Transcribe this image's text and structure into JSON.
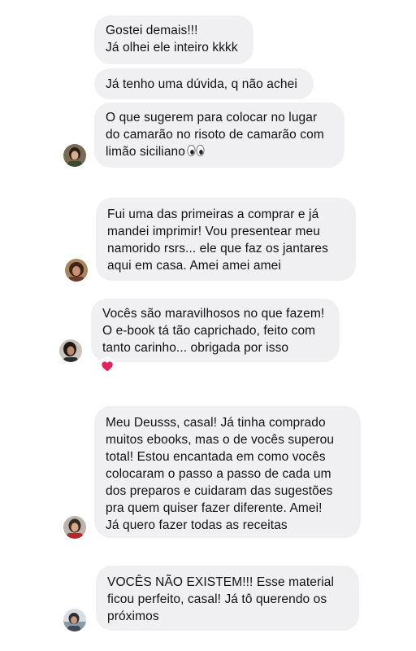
{
  "messages": [
    {
      "author": "user-1",
      "bubbles": [
        "Gostei demais!!!\nJá olhei ele inteiro kkkk",
        "Já tenho uma dúvida, q não achei",
        "O que sugerem para colocar no lugar\ndo camarão no risoto de camarão com\nlimão siciliano"
      ],
      "emoji": "eyes"
    },
    {
      "author": "user-2",
      "bubbles": [
        "Fui uma das primeiras a comprar e já\nmandei imprimir! Vou presentear meu\nnamorido rsrs... ele que faz os jantares\naqui em casa. Amei amei amei"
      ]
    },
    {
      "author": "user-3",
      "bubbles": [
        "Vocês são maravilhosos no que fazem!\nO e-book tá tão caprichado, feito com\ntanto carinho... obrigada por isso"
      ],
      "reaction": "heart"
    },
    {
      "author": "user-4",
      "bubbles": [
        "Meu Deusss, casal! Já tinha comprado\nmuitos ebooks, mas o de vocês superou\ntotal! Estou encantada em como vocês\ncolocaram o passo a passo de cada um\ndos preparos e cuidaram das sugestões\npra quem quiser fazer diferente. Amei!\nJá quero fazer todas as receitas"
      ]
    },
    {
      "author": "user-5",
      "bubbles": [
        "VOCÊS NÃO EXISTEM!!! Esse material\nficou perfeito, casal! Já tô querendo os\npróximos"
      ]
    }
  ],
  "colors": {
    "bubble": "#f0f0f2",
    "text": "#111111",
    "heart": "#e0245e"
  }
}
